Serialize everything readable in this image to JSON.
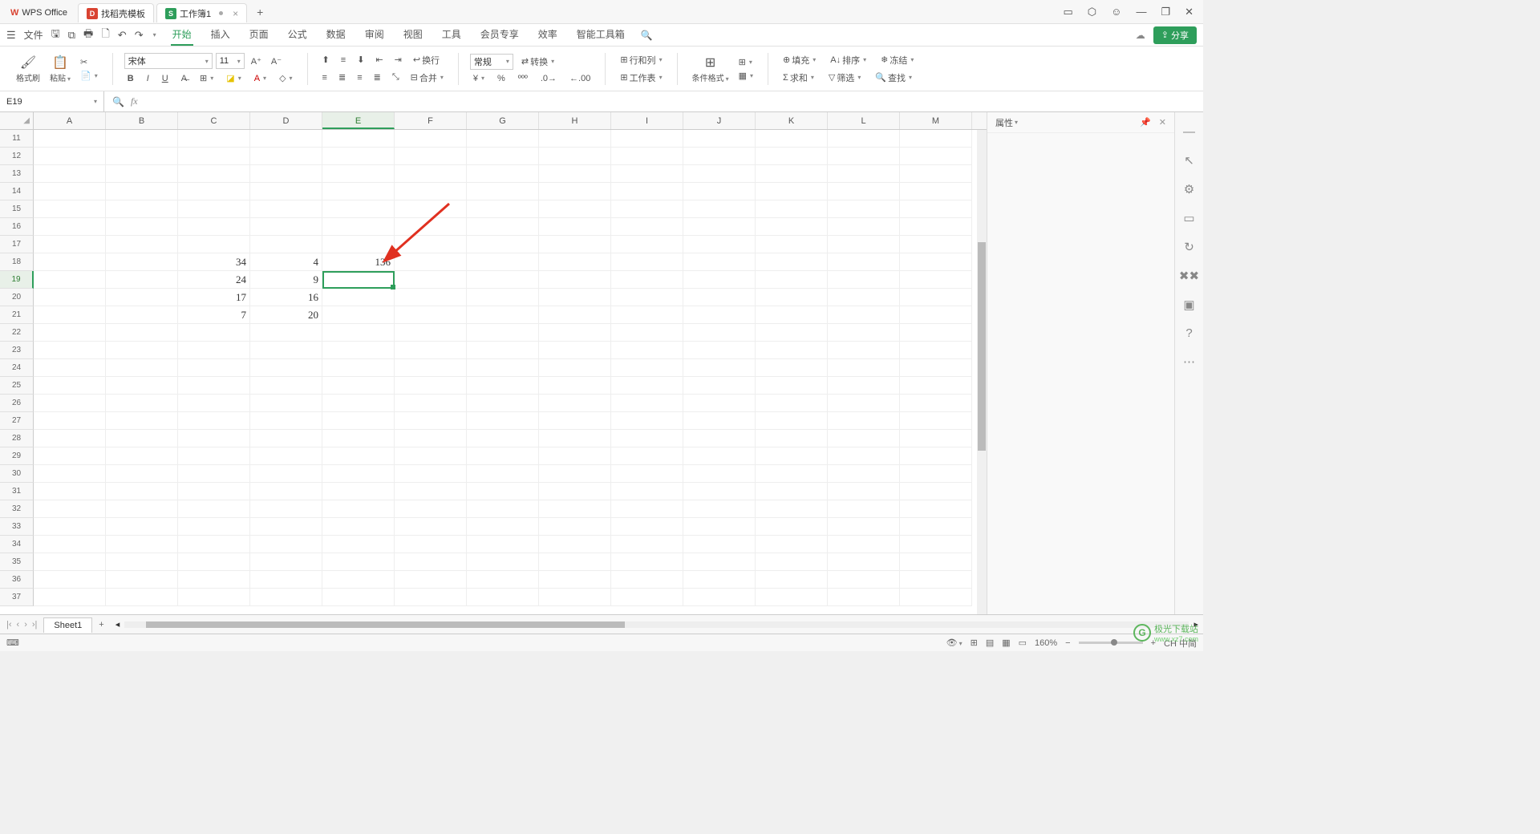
{
  "titlebar": {
    "wps": "WPS Office",
    "tab_template": "找稻壳模板",
    "tab_workbook": "工作簿1",
    "win_icons": [
      "▭",
      "⬡",
      "☺",
      "—",
      "❐",
      "✕"
    ]
  },
  "menubar": {
    "file": "文件",
    "items": [
      "开始",
      "插入",
      "页面",
      "公式",
      "数据",
      "审阅",
      "视图",
      "工具",
      "会员专享",
      "效率",
      "智能工具箱"
    ],
    "active": "开始",
    "share": "分享"
  },
  "ribbon": {
    "brush": "格式刷",
    "paste": "粘贴",
    "font": "宋体",
    "size": "11",
    "wrap": "换行",
    "format": "常规",
    "convert": "转换",
    "rowcol": "行和列",
    "worksheet": "工作表",
    "condfmt": "条件格式",
    "fill": "填充",
    "sort": "排序",
    "freeze": "冻结",
    "sum": "求和",
    "filter": "筛选",
    "find": "查找",
    "merge": "合并"
  },
  "namebox": "E19",
  "columns": [
    "A",
    "B",
    "C",
    "D",
    "E",
    "F",
    "G",
    "H",
    "I",
    "J",
    "K",
    "L",
    "M"
  ],
  "active_col": "E",
  "rows_start": 11,
  "rows_end": 37,
  "active_row": 19,
  "data": {
    "18": {
      "C": "34",
      "D": "4",
      "E": "136"
    },
    "19": {
      "C": "24",
      "D": "9"
    },
    "20": {
      "C": "17",
      "D": "16"
    },
    "21": {
      "C": "7",
      "D": "20"
    }
  },
  "rightpanel": {
    "title": "属性"
  },
  "sheet": {
    "name": "Sheet1"
  },
  "status": {
    "zoom": "160%",
    "ime": "CH 中简"
  },
  "watermark": {
    "brand": "极光下载站",
    "url": "www.xz7.com"
  }
}
